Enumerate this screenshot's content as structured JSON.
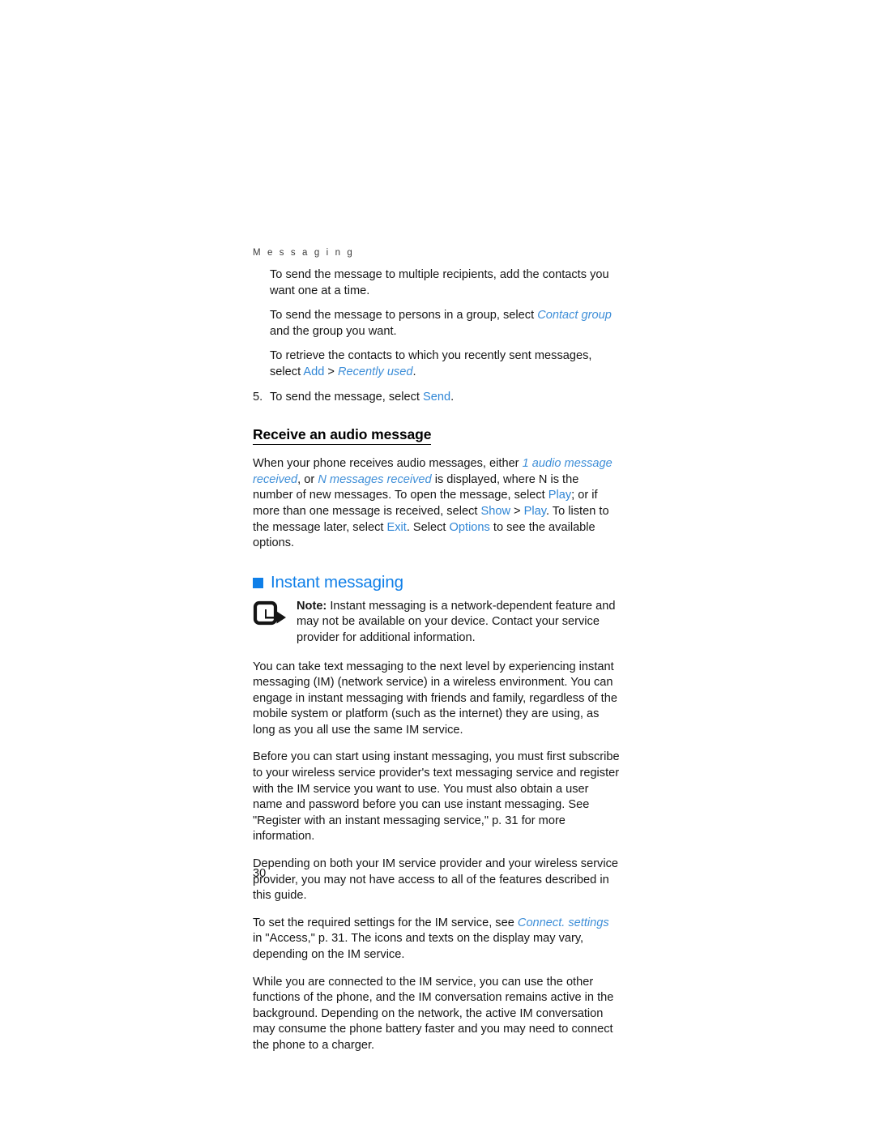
{
  "page": {
    "running_header": "M e s s a g i n g",
    "page_number": "30",
    "link_color": "#2f86d6",
    "heading_color": "#0f7fe8",
    "text_color": "#161616"
  },
  "steps_section": {
    "para_multiple_recipients": "To send the message to multiple recipients, add the contacts you want one at a time.",
    "para_group_prefix": "To send the message to persons in a group, select ",
    "para_group_link": "Contact group",
    "para_group_suffix": " and the group you want.",
    "para_recent_prefix": "To retrieve the contacts to which you recently sent messages, select ",
    "para_recent_link_add": "Add",
    "para_recent_sep": " > ",
    "para_recent_link_recently": "Recently used",
    "para_recent_suffix": ".",
    "step5_number": "5.",
    "step5_prefix": "To send the message, select ",
    "step5_link": "Send",
    "step5_suffix": "."
  },
  "audio_section": {
    "heading": "Receive an audio message",
    "body_1": "When your phone receives audio messages, either ",
    "link_1_audio": "1 audio message received",
    "body_2": ", or ",
    "link_n_messages": "N messages received",
    "body_3": " is displayed, where N is the number of new messages. To open the message, select ",
    "link_play_1": "Play",
    "body_4": "; or if more than one message is received, select ",
    "link_show": "Show",
    "body_5": " > ",
    "link_play_2": "Play",
    "body_6": ". To listen to the message later, select ",
    "link_exit": "Exit",
    "body_7": ". Select ",
    "link_options": "Options",
    "body_8": " to see the available options."
  },
  "im_section": {
    "heading": "Instant messaging",
    "note_label": "Note:",
    "note_text": " Instant messaging is a network-dependent feature and may not be available on your device. Contact your service provider for additional information.",
    "para_1": "You can take text messaging to the next level by experiencing instant messaging (IM) (network service) in a wireless environment. You can engage in instant messaging with friends and family, regardless of the mobile system or platform (such as the internet) they are using, as long as you all use the same IM service.",
    "para_2": "Before you can start using instant messaging, you must first subscribe to your wireless service provider's text messaging service and register with the IM service you want to use. You must also obtain a user name and password before you can use instant messaging. See \"Register with an instant messaging service,\" p. 31 for more information.",
    "para_3": "Depending on both your IM service provider and your wireless service provider, you may not have access to all of the features described in this guide.",
    "para_4_prefix": "To set the required settings for the IM service, see ",
    "para_4_link": "Connect. settings",
    "para_4_suffix": " in \"Access,\" p. 31. The icons and texts on the display may vary, depending on the IM service.",
    "para_5": "While you are connected to the IM service, you can use the other functions of the phone, and the IM conversation remains active in the background. Depending on the network, the active IM conversation may consume the phone battery faster and you may need to connect the phone to a charger."
  }
}
